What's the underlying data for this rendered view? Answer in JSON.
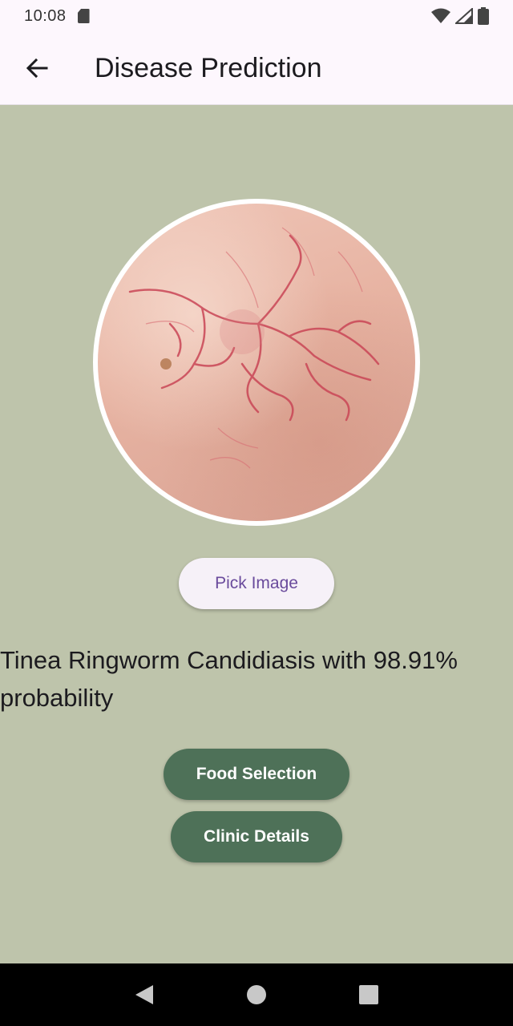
{
  "status_bar": {
    "time": "10:08",
    "icons": [
      "sd-card-icon",
      "wifi-icon",
      "signal-icon",
      "battery-icon"
    ]
  },
  "app_bar": {
    "title": "Disease Prediction",
    "back_icon": "arrow-left-icon"
  },
  "main": {
    "image_description_icon": "skin-photo",
    "pick_button_label": "Pick Image",
    "result_text": "Tinea Ringworm Candidiasis with 98.91% probability",
    "food_button_label": "Food Selection",
    "clinic_button_label": "Clinic Details"
  },
  "nav_bar": {
    "icons": [
      "back-triangle-icon",
      "home-circle-icon",
      "recents-square-icon"
    ]
  },
  "colors": {
    "background": "#bec4ab",
    "app_bar": "#fdf7fd",
    "primary_button": "#4e7158",
    "pick_button_text": "#6a4b9c"
  }
}
